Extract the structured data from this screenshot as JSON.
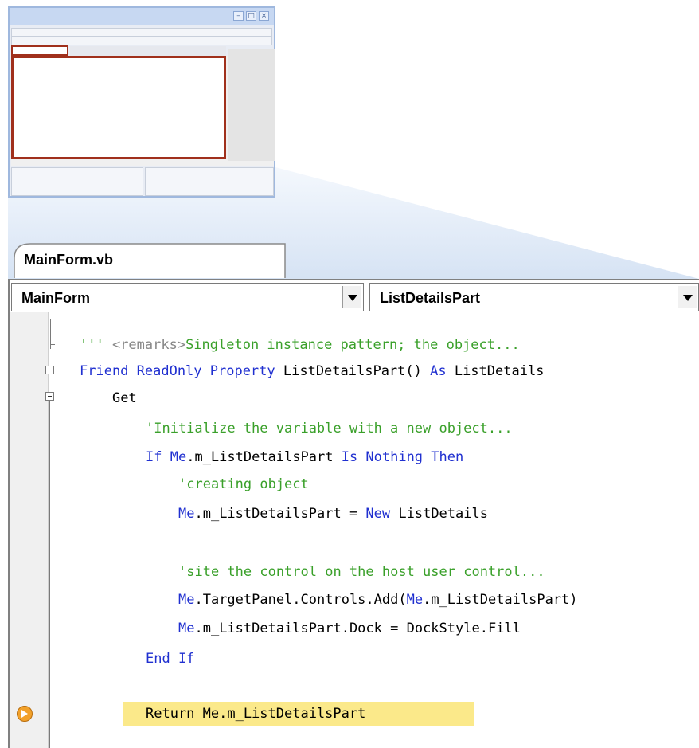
{
  "tab": {
    "filename": "MainForm.vb"
  },
  "toolbar": {
    "class_selector": "MainForm",
    "member_selector": "ListDetailsPart"
  },
  "thumbnail": {
    "title_buttons": [
      "minimize-icon",
      "maximize-icon",
      "close-icon"
    ]
  },
  "code_lines": {
    "l1": {
      "pre": "''' ",
      "tag": "<remarks>",
      "text": "Singleton instance pattern; the object..."
    },
    "l2": {
      "k1": "Friend ReadOnly Property",
      "t1": " ListDetailsPart() ",
      "k2": "As",
      "t2": " ListDetails"
    },
    "l3": {
      "t1": "Get"
    },
    "l4": {
      "c1": "'Initialize the variable with a new object..."
    },
    "l5": {
      "k1": "If",
      "k2": "Me",
      "t1": ".m_ListDetailsPart ",
      "k3": "Is Nothing Then"
    },
    "l6": {
      "c1": "'creating object"
    },
    "l7": {
      "k1": "Me",
      "t1": ".m_ListDetailsPart = ",
      "k2": "New",
      "t2": " ListDetails"
    },
    "l8": {
      "c1": "'site the control on the host user control..."
    },
    "l9": {
      "k1": "Me",
      "t1": ".TargetPanel.Controls.Add(",
      "k2": "Me",
      "t2": ".m_ListDetailsPart)"
    },
    "l10": {
      "k1": "Me",
      "t1": ".m_ListDetailsPart.Dock = DockStyle.Fill"
    },
    "l11": {
      "k1": "End If"
    },
    "l12": {
      "t1": "Return Me.m_ListDetailsPart"
    }
  },
  "colors": {
    "keyword": "#2030d0",
    "comment": "#3aa02a",
    "highlight": "#fbe98a",
    "callout_border": "#a0301c"
  }
}
